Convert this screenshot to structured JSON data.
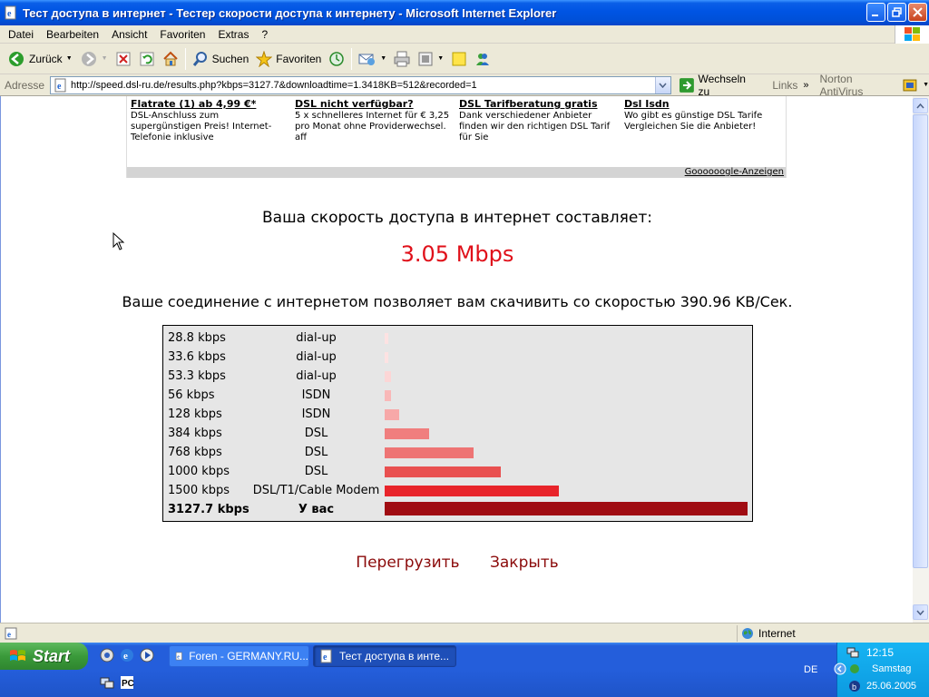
{
  "window": {
    "title": "Тест доступа в интернет - Тестер скорости доступа к интернету - Microsoft Internet Explorer"
  },
  "menu": [
    "Datei",
    "Bearbeiten",
    "Ansicht",
    "Favoriten",
    "Extras",
    "?"
  ],
  "toolbar": {
    "back_label": "Zurück",
    "search_label": "Suchen",
    "favorites_label": "Favoriten"
  },
  "address": {
    "label": "Adresse",
    "url": "http://speed.dsl-ru.de/results.php?kbps=3127.7&downloadtime=1.3418KB=512&recorded=1",
    "go_label": "Wechseln zu",
    "links_label": "Links",
    "norton_label": "Norton AntiVirus"
  },
  "ads": {
    "items": [
      {
        "title": "Flatrate (1) ab 4,99 €*",
        "text": "DSL-Anschluss zum supergünstigen Preis! Internet-Telefonie inklusive"
      },
      {
        "title": "DSL nicht verfügbar?",
        "text": "5 x schnelleres Internet für € 3,25 pro Monat ohne Providerwechsel. aff"
      },
      {
        "title": "DSL Tarifberatung gratis",
        "text": "Dank verschiedener Anbieter finden wir den richtigen DSL Tarif für Sie"
      },
      {
        "title": "Dsl Isdn",
        "text": "Wo gibt es günstige DSL Tarife Vergleichen Sie die Anbieter!"
      }
    ],
    "footer": "Goooooogle-Anzeigen"
  },
  "result": {
    "headline": "Ваша скорость доступа в интернет составляет:",
    "speed": "3.05 Mbps",
    "download_line": "Ваше соединение с интернетом позволяет вам скачивить со скоростью 390.96 KB/Сек."
  },
  "speed_table": {
    "rows": [
      {
        "rate": "28.8 kbps",
        "type": "dial-up",
        "kbps": 28.8,
        "color": "#fde2e2"
      },
      {
        "rate": "33.6 kbps",
        "type": "dial-up",
        "kbps": 33.6,
        "color": "#fde2e2"
      },
      {
        "rate": "53.3 kbps",
        "type": "dial-up",
        "kbps": 53.3,
        "color": "#fcd6d6"
      },
      {
        "rate": "56 kbps",
        "type": "ISDN",
        "kbps": 56,
        "color": "#f9b8b8"
      },
      {
        "rate": "128 kbps",
        "type": "ISDN",
        "kbps": 128,
        "color": "#f7a8a8"
      },
      {
        "rate": "384 kbps",
        "type": "DSL",
        "kbps": 384,
        "color": "#f07e7e"
      },
      {
        "rate": "768 kbps",
        "type": "DSL",
        "kbps": 768,
        "color": "#ee7474"
      },
      {
        "rate": "1000 kbps",
        "type": "DSL",
        "kbps": 1000,
        "color": "#e95050"
      },
      {
        "rate": "1500 kbps",
        "type": "DSL/T1/Cable Modem",
        "kbps": 1500,
        "color": "#e8242a"
      },
      {
        "rate": "3127.7 kbps",
        "type": "У вас",
        "kbps": 3127.7,
        "color": "#a00c12",
        "you": true
      }
    ],
    "max_kbps": 3127.7
  },
  "actions": {
    "reload": "Перегрузить",
    "close": "Закрыть"
  },
  "statusbar": {
    "zone": "Internet"
  },
  "taskbar": {
    "start_label": "Start",
    "tasks": [
      "Foren - GERMANY.RU...",
      "Тест доступа в инте..."
    ],
    "language": "DE",
    "time": "12:15",
    "day": "Samstag",
    "date": "25.06.2005"
  }
}
